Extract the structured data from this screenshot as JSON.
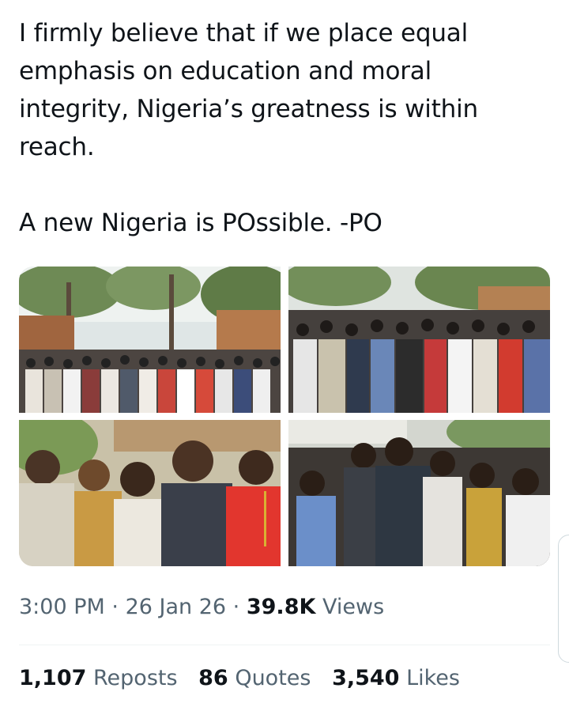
{
  "tweet": {
    "text_lines": [
      "I firmly believe that if we place equal emphasis on education and moral integrity, Nigeria’s greatness is within reach.",
      "A new Nigeria is POssible. -PO"
    ]
  },
  "media": {
    "photos": [
      {
        "name": "photo-group-wide"
      },
      {
        "name": "photo-group-close"
      },
      {
        "name": "photo-selfie-students"
      },
      {
        "name": "photo-crowd-candid"
      }
    ]
  },
  "meta": {
    "time": "3:00 PM",
    "separator": "·",
    "date": "26 Jan 26",
    "views_count": "39.8K",
    "views_label": "Views"
  },
  "stats": {
    "reposts_count": "1,107",
    "reposts_label": "Reposts",
    "quotes_count": "86",
    "quotes_label": "Quotes",
    "likes_count": "3,540",
    "likes_label": "Likes"
  },
  "colors": {
    "text": "#0f1419",
    "secondary": "#536471",
    "divider": "#eff3f4"
  }
}
